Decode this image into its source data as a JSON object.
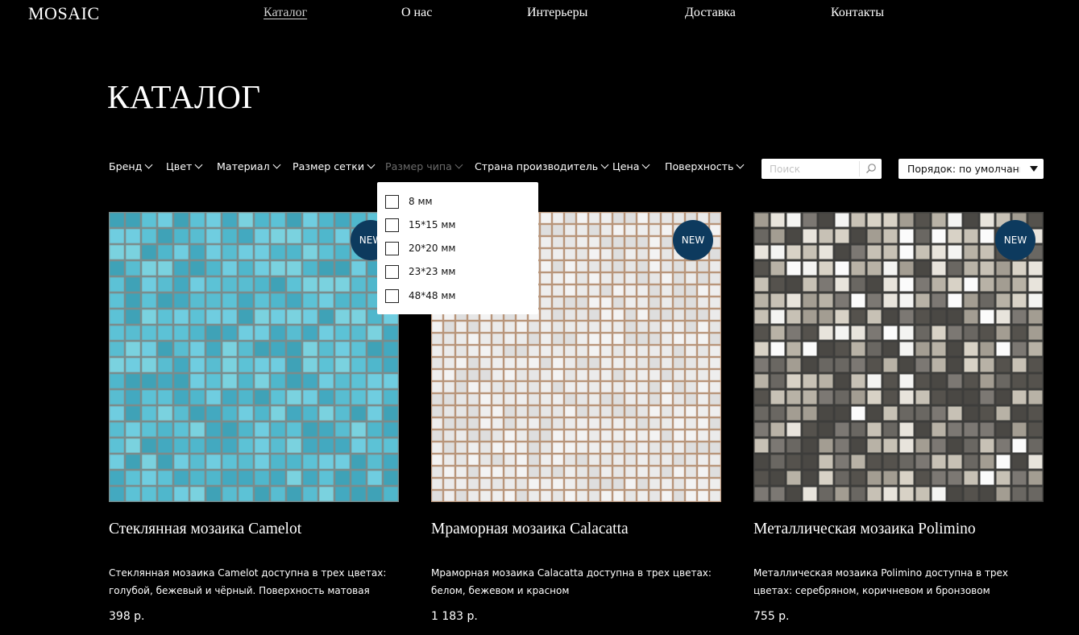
{
  "header": {
    "logo": "MOSAIC",
    "nav": [
      "Каталог",
      "О нас",
      "Интерьеры",
      "Доставка",
      "Контакты"
    ],
    "active_nav": "Каталог"
  },
  "page_title": "КАТАЛОГ",
  "filters": [
    {
      "label": "Бренд",
      "active": false
    },
    {
      "label": "Цвет",
      "active": false
    },
    {
      "label": "Материал",
      "active": false
    },
    {
      "label": "Размер сетки",
      "active": false
    },
    {
      "label": "Размер чипа",
      "active": true
    },
    {
      "label": "Страна производитель",
      "active": false
    },
    {
      "label": "Цена",
      "active": false
    },
    {
      "label": "Поверхность",
      "active": false
    }
  ],
  "search": {
    "placeholder": "Поиск",
    "icon": "search-icon"
  },
  "sort": {
    "label": "Порядок: по умолчани",
    "icon": "triangle-down-icon"
  },
  "chip_size_dropdown": {
    "options": [
      "8 мм",
      "15*15 мм",
      "20*20 мм",
      "23*23 мм",
      "48*48 мм"
    ],
    "checked": [
      false,
      false,
      false,
      false,
      false
    ]
  },
  "products": [
    {
      "badge": "NEW",
      "name": "Стеклянная мозаика Camelot",
      "description": "Стеклянная мозаика Camelot доступна в трех цветах: голубой, бежевый и чёрный. Поверхность матовая",
      "price": "398 р."
    },
    {
      "badge": "NEW",
      "name": "Мраморная мозаика Calacatta",
      "description": "Мраморная мозаика Calacatta доступна в трех цветах: белом, бежевом и красном",
      "price": "1 183 р."
    },
    {
      "badge": "NEW",
      "name": "Металлическая мозаика Polimino",
      "description": "Металлическая мозаика Polimino доступна в трех цветах: серебряном, коричневом и бронзовом",
      "price": "755 р."
    }
  ],
  "colors": {
    "background": "#000000",
    "badge": "#0d3a5e",
    "dimmed_filter": "#6c6c6c"
  }
}
